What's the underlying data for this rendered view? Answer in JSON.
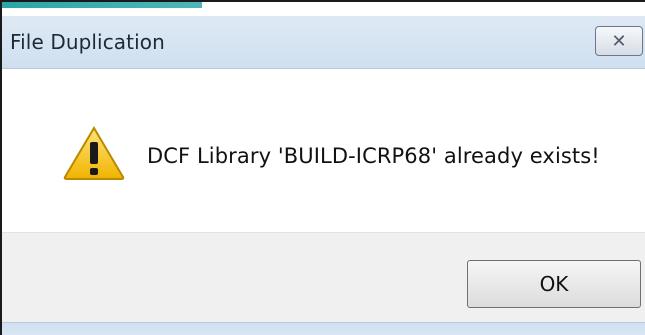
{
  "dialog": {
    "title": "File Duplication",
    "close_icon": "close-icon",
    "message": "DCF Library 'BUILD-ICRP68' already exists!",
    "warning_icon": "warning-icon",
    "ok_label": "OK"
  },
  "colors": {
    "titlebar": "#dfe9f4",
    "footer": "#f0f0f0",
    "accent": "#2aa6a8",
    "warning_yellow": "#f3c316"
  }
}
